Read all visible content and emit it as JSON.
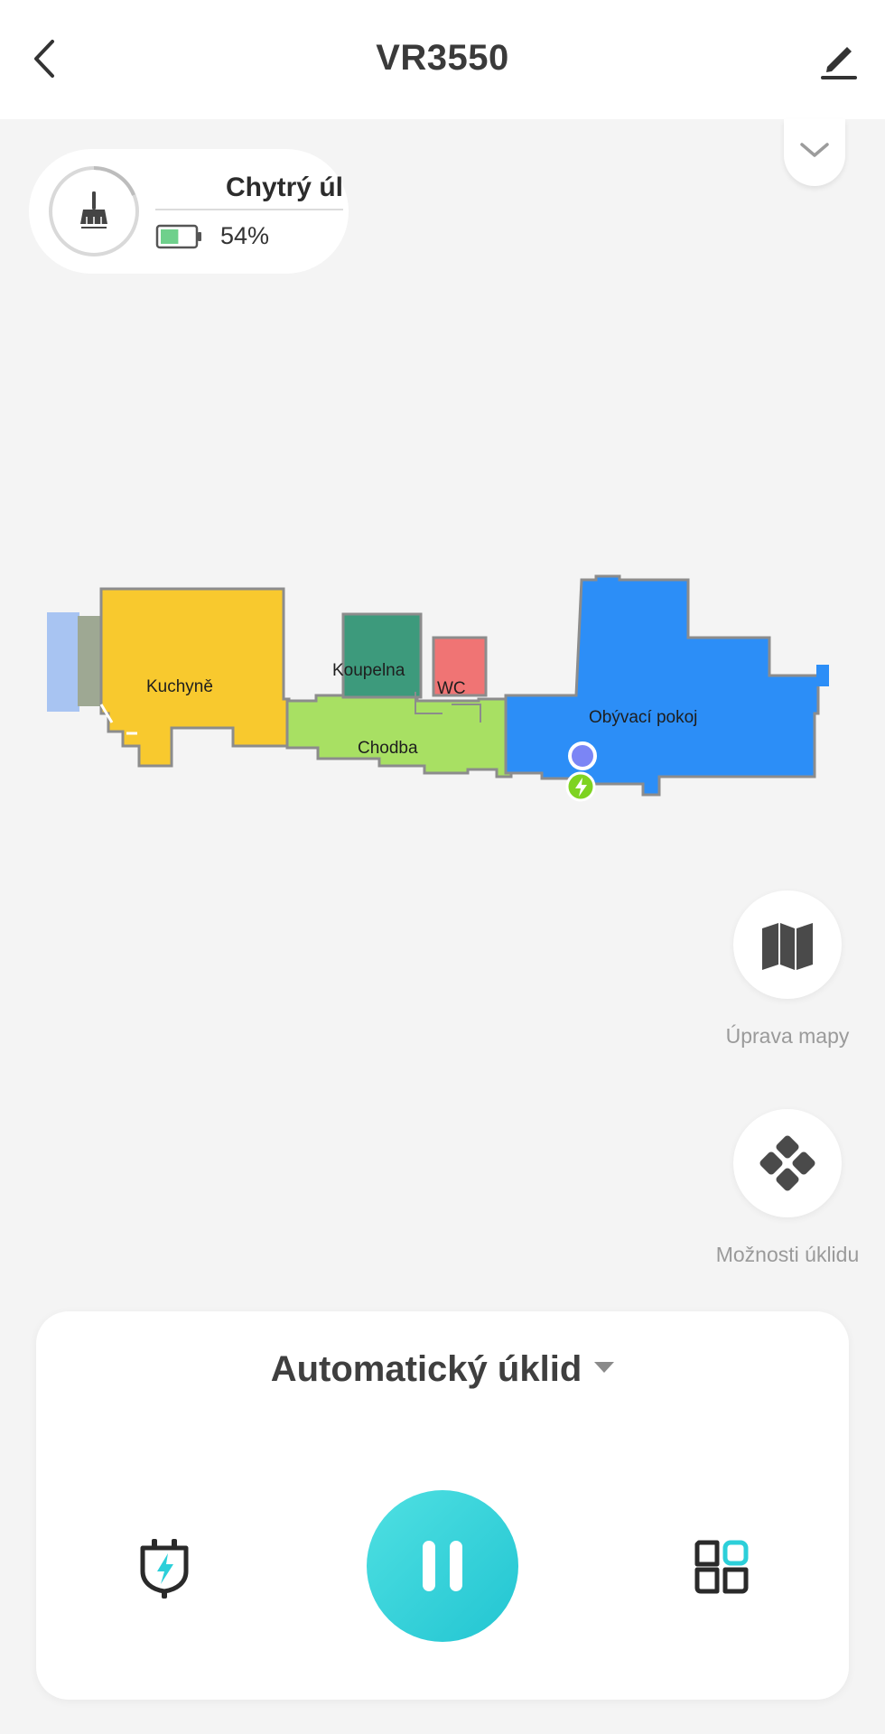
{
  "header": {
    "title": "VR3550",
    "back_icon": "chevron-left-icon",
    "edit_icon": "pencil-icon"
  },
  "status": {
    "mode_name": "Chytrý úl",
    "battery_percent": 54,
    "battery_text": "54%",
    "mode_icon": "broom-icon"
  },
  "map": {
    "rooms": [
      {
        "name": "Kuchyně",
        "color": "#f8c92e"
      },
      {
        "name": "Koupelna",
        "color": "#3d9a7c"
      },
      {
        "name": "WC",
        "color": "#f07474"
      },
      {
        "name": "Chodba",
        "color": "#a8e063"
      },
      {
        "name": "Obývací pokoj",
        "color": "#2c8ef7"
      }
    ]
  },
  "actions": {
    "map_edit_label": "Úprava mapy",
    "cleaning_options_label": "Možnosti úklidu"
  },
  "control": {
    "cleaning_mode": "Automatický úklid",
    "dock_icon": "charging-dock-icon",
    "pause_icon": "pause-icon",
    "rooms_icon": "room-grid-icon"
  },
  "colors": {
    "accent": "#2ccfd9",
    "background": "#f4f4f4",
    "battery_fill": "#6fd08c",
    "charging_marker": "#7ed321",
    "robot_marker": "#7b85f5"
  }
}
